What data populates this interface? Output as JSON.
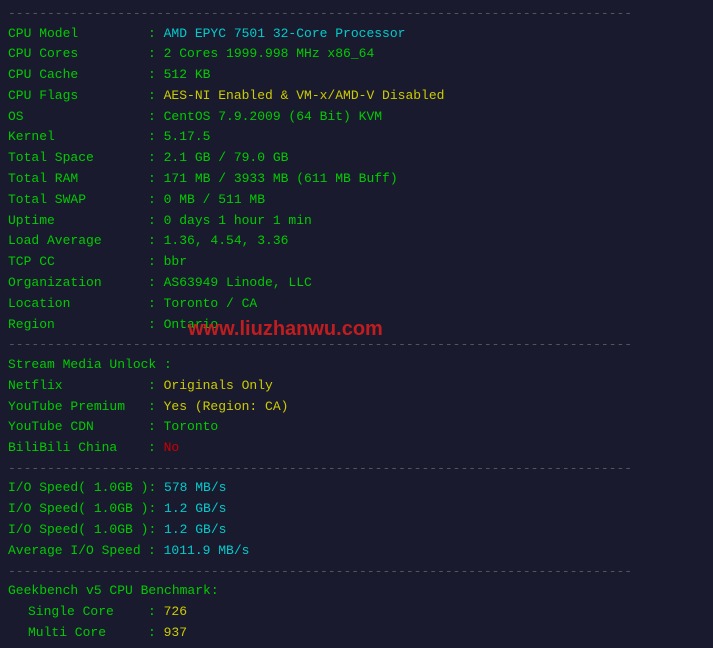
{
  "separator": "--------------------------------------------------------------------------------",
  "rows": [
    {
      "label": "CPU Model",
      "value": "AMD EPYC 7501 32-Core Processor",
      "color": "value-cyan"
    },
    {
      "label": "CPU Cores",
      "value": "2 Cores 1999.998 MHz x86_64",
      "color": "value-green"
    },
    {
      "label": "CPU Cache",
      "value": "512 KB",
      "color": "value-green"
    },
    {
      "label": "CPU Flags",
      "value": "AES-NI Enabled & VM-x/AMD-V Disabled",
      "color": "value-yellow"
    },
    {
      "label": "OS",
      "value": "CentOS 7.9.2009 (64 Bit) KVM",
      "color": "value-green"
    },
    {
      "label": "Kernel",
      "value": "5.17.5",
      "color": "value-green"
    },
    {
      "label": "Total Space",
      "value": "2.1 GB / 79.0 GB",
      "color": "value-green"
    },
    {
      "label": "Total RAM",
      "value": "171 MB / 3933 MB (611 MB Buff)",
      "color": "value-green"
    },
    {
      "label": "Total SWAP",
      "value": "0 MB / 511 MB",
      "color": "value-green"
    },
    {
      "label": "Uptime",
      "value": "0 days 1 hour 1 min",
      "color": "value-green"
    },
    {
      "label": "Load Average",
      "value": "1.36, 4.54, 3.36",
      "color": "value-green"
    },
    {
      "label": "TCP CC",
      "value": "bbr",
      "color": "value-green"
    },
    {
      "label": "Organization",
      "value": "AS63949 Linode, LLC",
      "color": "value-green"
    },
    {
      "label": "Location",
      "value": "Toronto / CA",
      "color": "value-green"
    },
    {
      "label": "Region",
      "value": "Ontario",
      "color": "value-green"
    }
  ],
  "unlock_section": {
    "header": "Stream Media Unlock :",
    "items": [
      {
        "label": "Netflix",
        "value": "Originals Only",
        "color": "value-yellow"
      },
      {
        "label": "YouTube Premium",
        "value": "Yes (Region: CA)",
        "color": "value-yellow"
      },
      {
        "label": "YouTube CDN",
        "value": "Toronto",
        "color": "value-green"
      },
      {
        "label": "BiliBili China",
        "value": "No",
        "color": "value-red"
      }
    ]
  },
  "io_section": {
    "items": [
      {
        "label": "I/O Speed( 1.0GB )",
        "value": "578 MB/s",
        "color": "value-cyan"
      },
      {
        "label": "I/O Speed( 1.0GB )",
        "value": "1.2 GB/s",
        "color": "value-cyan"
      },
      {
        "label": "I/O Speed( 1.0GB )",
        "value": "1.2 GB/s",
        "color": "value-cyan"
      },
      {
        "label": "Average I/O Speed",
        "value": "1011.9 MB/s",
        "color": "value-cyan"
      }
    ]
  },
  "geekbench_section": {
    "header": "Geekbench v5 CPU Benchmark:",
    "items": [
      {
        "label": "Single Core",
        "value": "726",
        "color": "value-yellow"
      },
      {
        "label": "Multi Core",
        "value": "937",
        "color": "value-yellow"
      }
    ]
  },
  "watermark": "www.liuzhanwu.com",
  "colon": " : "
}
